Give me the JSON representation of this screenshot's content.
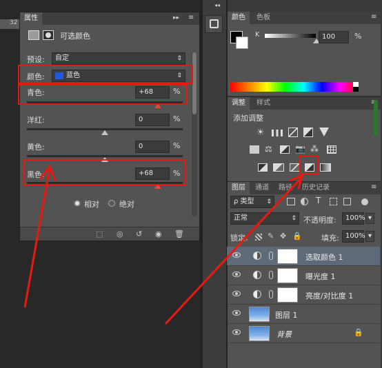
{
  "properties_panel": {
    "tab_label": "属性",
    "title": "可选颜色",
    "preset_label": "预设:",
    "preset_value": "自定",
    "color_label": "颜色:",
    "color_value": "蓝色",
    "color_swatch": "#1e5be0",
    "sliders": [
      {
        "label": "青色:",
        "value": "+68",
        "unit": "%",
        "level": 0.84
      },
      {
        "label": "洋红:",
        "value": "0",
        "unit": "%",
        "level": 0.5
      },
      {
        "label": "黄色:",
        "value": "0",
        "unit": "%",
        "level": 0.5
      },
      {
        "label": "黑色:",
        "value": "+68",
        "unit": "%",
        "level": 0.84
      }
    ],
    "mode_relative": "相对",
    "mode_absolute": "绝对"
  },
  "color_panel": {
    "tabs": [
      "颜色",
      "色板"
    ],
    "k_label": "K",
    "k_value": "100",
    "k_unit": "%"
  },
  "adjustments_panel": {
    "tabs": [
      "调整",
      "样式"
    ],
    "add_label": "添加调整"
  },
  "layers_panel": {
    "tabs": [
      "图层",
      "通道",
      "路径",
      "历史记录"
    ],
    "filter_label": "ρ 类型",
    "blend_mode": "正常",
    "opacity_label": "不透明度:",
    "opacity_value": "100%",
    "lock_label": "锁定:",
    "fill_label": "填充:",
    "fill_value": "100%",
    "layers": [
      {
        "name": "选取颜色 1",
        "type": "adjustment"
      },
      {
        "name": "曝光度 1",
        "type": "adjustment"
      },
      {
        "name": "亮度/对比度 1",
        "type": "adjustment"
      },
      {
        "name": "图层 1",
        "type": "image"
      },
      {
        "name": "背景",
        "type": "background"
      }
    ]
  },
  "colors": {
    "annotation_red": "#e81a10",
    "panel_bg": "#535353"
  }
}
